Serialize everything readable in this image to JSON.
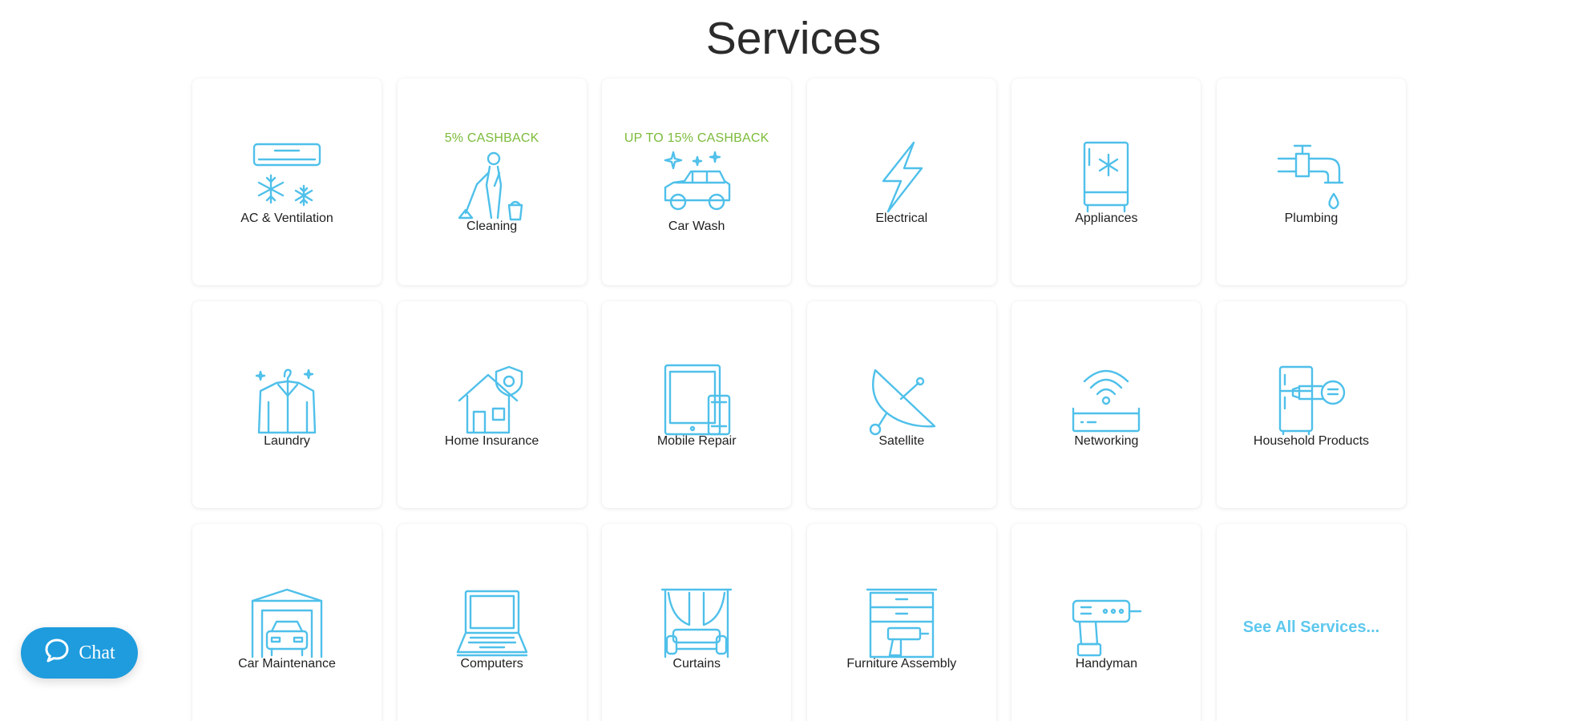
{
  "page": {
    "title": "Services"
  },
  "services": [
    {
      "label": "AC & Ventilation",
      "promo": "",
      "icon": "ac-icon"
    },
    {
      "label": "Cleaning",
      "promo": "5% CASHBACK",
      "icon": "cleaning-icon"
    },
    {
      "label": "Car Wash",
      "promo": "UP TO 15% CASHBACK",
      "icon": "car-wash-icon"
    },
    {
      "label": "Electrical",
      "promo": "",
      "icon": "lightning-icon"
    },
    {
      "label": "Appliances",
      "promo": "",
      "icon": "fridge-icon"
    },
    {
      "label": "Plumbing",
      "promo": "",
      "icon": "faucet-icon"
    },
    {
      "label": "Laundry",
      "promo": "",
      "icon": "shirt-hanger-icon"
    },
    {
      "label": "Home Insurance",
      "promo": "",
      "icon": "house-shield-icon"
    },
    {
      "label": "Mobile Repair",
      "promo": "",
      "icon": "tablet-phone-icon"
    },
    {
      "label": "Satellite",
      "promo": "",
      "icon": "satellite-dish-icon"
    },
    {
      "label": "Networking",
      "promo": "",
      "icon": "router-icon"
    },
    {
      "label": "Household Products",
      "promo": "",
      "icon": "fridge-hairdryer-icon"
    },
    {
      "label": "Car Maintenance",
      "promo": "",
      "icon": "garage-car-icon"
    },
    {
      "label": "Computers",
      "promo": "",
      "icon": "laptop-icon"
    },
    {
      "label": "Curtains",
      "promo": "",
      "icon": "curtains-sofa-icon"
    },
    {
      "label": "Furniture Assembly",
      "promo": "",
      "icon": "furniture-drill-icon"
    },
    {
      "label": "Handyman",
      "promo": "",
      "icon": "drill-icon"
    }
  ],
  "see_all": {
    "label": "See All Services..."
  },
  "chat": {
    "label": "Chat",
    "icon": "chat-bubble-icon"
  },
  "colors": {
    "icon_accent": "#4fc0ea",
    "promo_green": "#7cbb3a",
    "chat_blue": "#1e9cde",
    "see_all_blue": "#5ec8ee"
  }
}
